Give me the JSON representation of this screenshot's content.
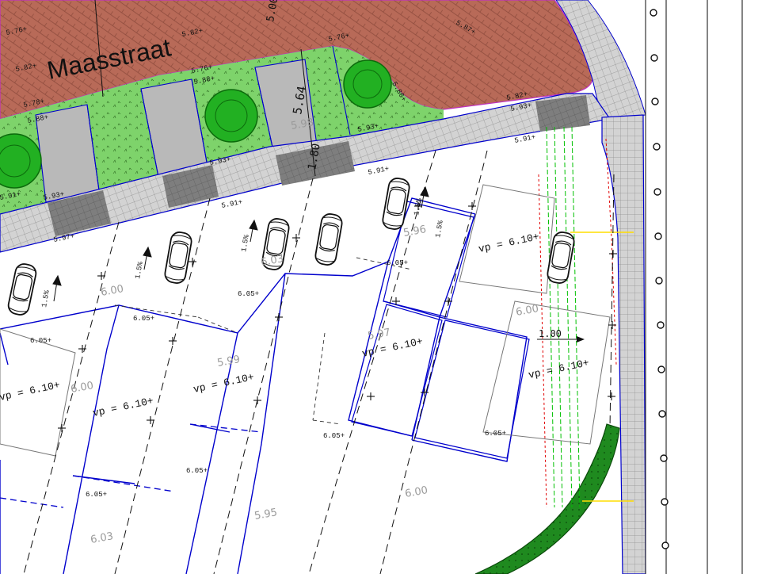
{
  "street_name": "Maasstraat",
  "dimensions": {
    "width_1": "5.00",
    "width_2": "5.64",
    "width_3": "1.80",
    "offset": "1.00"
  },
  "levels_top": [
    "5.76+",
    "5.82+",
    "5.82+",
    "5.76+",
    "5.76+",
    "5.88+",
    "5.86+",
    "5.87+",
    "5.82+",
    "5.78+"
  ],
  "levels_kerb": [
    "5.88+",
    "5.93+",
    "5.93+",
    "5.91+",
    "5.97+",
    "5.91+",
    "5.91+",
    "5.93+",
    "5.93+",
    "5.91+"
  ],
  "levels_mid": [
    "6.05+",
    "6.05+",
    "6.05+",
    "6.05+",
    "6.05+",
    "6.05+",
    "6.05+",
    "6.05+"
  ],
  "vp_labels": [
    "vp = 6.10+",
    "vp = 6.10+",
    "vp = 6.10+",
    "vp = 6.10+",
    "vp = 6.10+",
    "vp = 6.10+"
  ],
  "slopes": [
    "1.5%",
    "1.5%",
    "1.5%",
    "1.5%",
    "1.5%"
  ],
  "ghost_levels": [
    "5.98",
    "6.00",
    "6.03",
    "5.99",
    "5.97",
    "6.00",
    "5.95",
    "6.03",
    "5.96",
    "6.00",
    "6.00"
  ],
  "colors": {
    "paving_brick": "#b86a58",
    "pavement": "#cfcfcf",
    "grass": "#7ed36b",
    "tree": "#22b022",
    "boundary": "#0000cc",
    "red_markup": "#e00000",
    "green_markup": "#00cc00",
    "yellow_line": "#ffdd00",
    "hedge": "#1a7a1a"
  },
  "icons": [
    "car-icon",
    "tree-icon",
    "slope-arrow-icon"
  ]
}
